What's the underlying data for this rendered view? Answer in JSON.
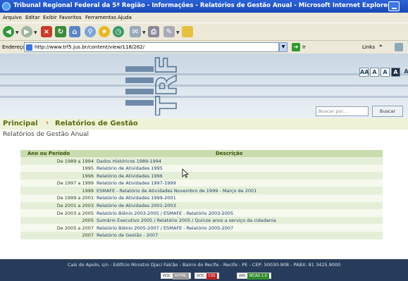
{
  "window": {
    "title": "Tribunal Regional Federal da 5ª Região - Informações - Relatórios de Gestão Anual - Microsoft Internet Explorer"
  },
  "menu": [
    "Arquivo",
    "Editar",
    "Exibir",
    "Favoritos",
    "Ferramentas",
    "Ajuda"
  ],
  "toolbar": {
    "icons": [
      "back-icon",
      "forward-icon",
      "stop-icon",
      "refresh-icon",
      "home-icon",
      "search-icon",
      "favorites-icon",
      "history-icon",
      "mail-icon",
      "print-icon",
      "edit-icon",
      "folder-icon"
    ]
  },
  "address": {
    "label": "Endereço",
    "url": "http://www.trf5.jus.br/content/view/118/262/",
    "go_label": "Ir",
    "links_label": "Links",
    "more": "»"
  },
  "banner": {
    "logo_text": "TRF5",
    "font_controls": [
      "AA",
      "A",
      "A",
      "A",
      "A"
    ],
    "search_placeholder": "Buscar por...",
    "search_button": "Buscar"
  },
  "breadcrumb": {
    "home": "Principal",
    "separator": "›",
    "current": "Relatórios de Gestão"
  },
  "page_heading": "Relatórios de Gestão Anual",
  "table": {
    "headers": [
      "Ano ou Período",
      "Descrição"
    ],
    "rows": [
      {
        "period": "De 1989 a 1994",
        "desc": "Dados Históricos 1989-1994"
      },
      {
        "period": "1995",
        "desc": "Relatório de Atividades 1995"
      },
      {
        "period": "1996",
        "desc": "Relatório de Atividades 1996"
      },
      {
        "period": "De 1997 a 1999",
        "desc": "Relatório de Atividades 1997-1999"
      },
      {
        "period": "1999",
        "desc": "ESMAFE - Relatório de Atividades Novembro de 1999 - Março de 2001"
      },
      {
        "period": "De 1999 a 2001",
        "desc": "Relatório de Atividades 1999-2001"
      },
      {
        "period": "De 2001 a 2003",
        "desc": "Relatório de Atividades 2001-2003"
      },
      {
        "period": "De 2003 a 2005",
        "desc": "Relatório Biênio 2003-2005 / ESMAFE - Relatório 2003-2005"
      },
      {
        "period": "2005",
        "desc": "Sumário Executivo 2005 / Relatório 2005 / Quinze anos a serviço da cidadania"
      },
      {
        "period": "De 2005 a 2007",
        "desc": "Relatório Biênio 2005-2007 / ESMAFE - Relatório 2005-2007"
      },
      {
        "period": "2007",
        "desc": "Relatório de Gestão - 2007"
      }
    ]
  },
  "footer": {
    "address": "Cais do Apolo, s/n - Edifício Ministro Djaci Falcão - Bairro do Recife - Recife - PE - CEP: 50030-908 - PABX: 81 3425.9000",
    "badges": [
      {
        "label": "W3C",
        "tag": "XHTML",
        "color": "#9a9a9a"
      },
      {
        "label": "W3C",
        "tag": "CSS",
        "color": "#c02020"
      },
      {
        "label": "WAI",
        "tag": "WCAG 1.0",
        "color": "#2f8a2f"
      }
    ]
  },
  "colors": {
    "title_bar": "#2a63d8",
    "banner": "#c7d6e2",
    "breadcrumb_text": "#5a6b12",
    "breadcrumb_separator": "#e06a18",
    "table_header": "#c9dcae",
    "footer": "#263c5a"
  }
}
